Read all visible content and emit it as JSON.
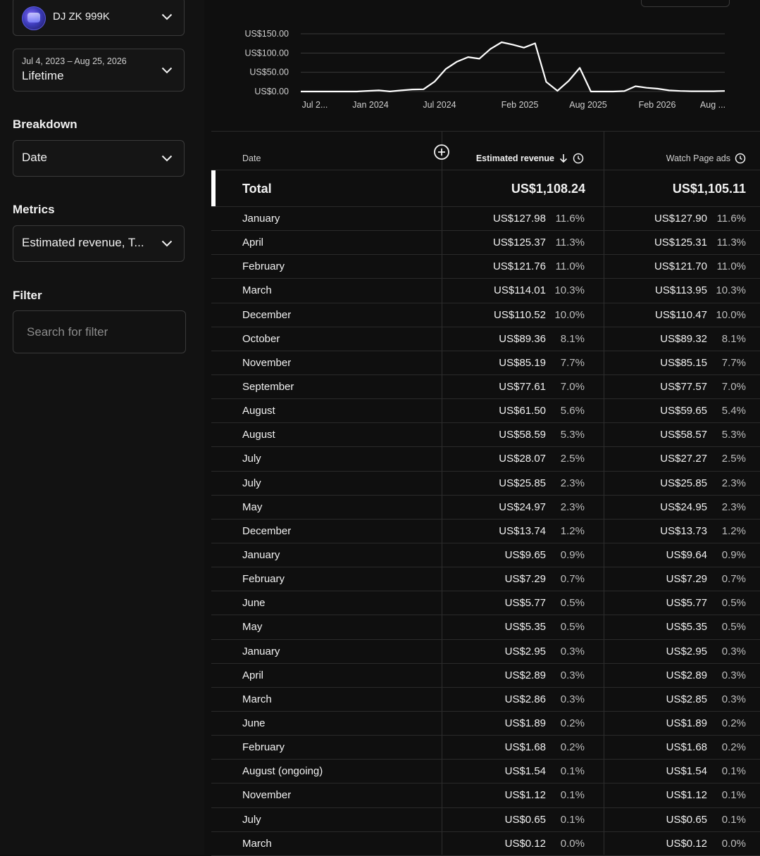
{
  "sidebar": {
    "channel": {
      "name": "DJ ZK 999K"
    },
    "date": {
      "range": "Jul 4, 2023 – Aug 25, 2026",
      "label": "Lifetime"
    },
    "breakdown": {
      "label": "Breakdown",
      "value": "Date"
    },
    "metrics": {
      "label": "Metrics",
      "value": "Estimated revenue, T..."
    },
    "filter": {
      "label": "Filter",
      "placeholder": "Search for filter"
    }
  },
  "chart_data": {
    "type": "line",
    "x_ticks": [
      "Jul 2...",
      "Jan 2024",
      "Jul 2024",
      "Feb 2025",
      "Aug 2025",
      "Feb 2026",
      "Aug ..."
    ],
    "y_ticks": [
      "US$150.00",
      "US$100.00",
      "US$50.00",
      "US$0.00"
    ],
    "ylim": [
      0,
      150
    ],
    "grid": true,
    "series": [
      {
        "values": [
          0,
          0,
          0,
          0,
          0,
          0,
          1.68,
          2.95,
          0.12,
          2.89,
          5.35,
          5.77,
          25.85,
          58.59,
          77.61,
          89.36,
          85.19,
          110.52,
          127.98,
          121.76,
          114.01,
          125.37,
          24.97,
          1.89,
          27.27,
          61.5,
          0,
          0,
          0,
          1.12,
          13.74,
          9.65,
          7.29,
          2.86,
          1.54,
          0.65,
          0.65,
          0.65,
          1.54
        ]
      }
    ]
  },
  "table": {
    "headers": {
      "date": "Date",
      "revenue": "Estimated revenue",
      "watch": "Watch Page ads"
    },
    "total": {
      "label": "Total",
      "revenue": "US$1,108.24",
      "watch": "US$1,105.11"
    },
    "rows": [
      {
        "label": "January",
        "rev": "US$127.98",
        "rev_pct": "11.6%",
        "wpa": "US$127.90",
        "wpa_pct": "11.6%"
      },
      {
        "label": "April",
        "rev": "US$125.37",
        "rev_pct": "11.3%",
        "wpa": "US$125.31",
        "wpa_pct": "11.3%"
      },
      {
        "label": "February",
        "rev": "US$121.76",
        "rev_pct": "11.0%",
        "wpa": "US$121.70",
        "wpa_pct": "11.0%"
      },
      {
        "label": "March",
        "rev": "US$114.01",
        "rev_pct": "10.3%",
        "wpa": "US$113.95",
        "wpa_pct": "10.3%"
      },
      {
        "label": "December",
        "rev": "US$110.52",
        "rev_pct": "10.0%",
        "wpa": "US$110.47",
        "wpa_pct": "10.0%"
      },
      {
        "label": "October",
        "rev": "US$89.36",
        "rev_pct": "8.1%",
        "wpa": "US$89.32",
        "wpa_pct": "8.1%"
      },
      {
        "label": "November",
        "rev": "US$85.19",
        "rev_pct": "7.7%",
        "wpa": "US$85.15",
        "wpa_pct": "7.7%"
      },
      {
        "label": "September",
        "rev": "US$77.61",
        "rev_pct": "7.0%",
        "wpa": "US$77.57",
        "wpa_pct": "7.0%"
      },
      {
        "label": "August",
        "rev": "US$61.50",
        "rev_pct": "5.6%",
        "wpa": "US$59.65",
        "wpa_pct": "5.4%"
      },
      {
        "label": "August",
        "rev": "US$58.59",
        "rev_pct": "5.3%",
        "wpa": "US$58.57",
        "wpa_pct": "5.3%"
      },
      {
        "label": "July",
        "rev": "US$28.07",
        "rev_pct": "2.5%",
        "wpa": "US$27.27",
        "wpa_pct": "2.5%"
      },
      {
        "label": "July",
        "rev": "US$25.85",
        "rev_pct": "2.3%",
        "wpa": "US$25.85",
        "wpa_pct": "2.3%"
      },
      {
        "label": "May",
        "rev": "US$24.97",
        "rev_pct": "2.3%",
        "wpa": "US$24.95",
        "wpa_pct": "2.3%"
      },
      {
        "label": "December",
        "rev": "US$13.74",
        "rev_pct": "1.2%",
        "wpa": "US$13.73",
        "wpa_pct": "1.2%"
      },
      {
        "label": "January",
        "rev": "US$9.65",
        "rev_pct": "0.9%",
        "wpa": "US$9.64",
        "wpa_pct": "0.9%"
      },
      {
        "label": "February",
        "rev": "US$7.29",
        "rev_pct": "0.7%",
        "wpa": "US$7.29",
        "wpa_pct": "0.7%"
      },
      {
        "label": "June",
        "rev": "US$5.77",
        "rev_pct": "0.5%",
        "wpa": "US$5.77",
        "wpa_pct": "0.5%"
      },
      {
        "label": "May",
        "rev": "US$5.35",
        "rev_pct": "0.5%",
        "wpa": "US$5.35",
        "wpa_pct": "0.5%"
      },
      {
        "label": "January",
        "rev": "US$2.95",
        "rev_pct": "0.3%",
        "wpa": "US$2.95",
        "wpa_pct": "0.3%"
      },
      {
        "label": "April",
        "rev": "US$2.89",
        "rev_pct": "0.3%",
        "wpa": "US$2.89",
        "wpa_pct": "0.3%"
      },
      {
        "label": "March",
        "rev": "US$2.86",
        "rev_pct": "0.3%",
        "wpa": "US$2.85",
        "wpa_pct": "0.3%"
      },
      {
        "label": "June",
        "rev": "US$1.89",
        "rev_pct": "0.2%",
        "wpa": "US$1.89",
        "wpa_pct": "0.2%"
      },
      {
        "label": "February",
        "rev": "US$1.68",
        "rev_pct": "0.2%",
        "wpa": "US$1.68",
        "wpa_pct": "0.2%"
      },
      {
        "label": "August (ongoing)",
        "rev": "US$1.54",
        "rev_pct": "0.1%",
        "wpa": "US$1.54",
        "wpa_pct": "0.1%"
      },
      {
        "label": "November",
        "rev": "US$1.12",
        "rev_pct": "0.1%",
        "wpa": "US$1.12",
        "wpa_pct": "0.1%"
      },
      {
        "label": "July",
        "rev": "US$0.65",
        "rev_pct": "0.1%",
        "wpa": "US$0.65",
        "wpa_pct": "0.1%"
      },
      {
        "label": "March",
        "rev": "US$0.12",
        "rev_pct": "0.0%",
        "wpa": "US$0.12",
        "wpa_pct": "0.0%"
      }
    ]
  }
}
